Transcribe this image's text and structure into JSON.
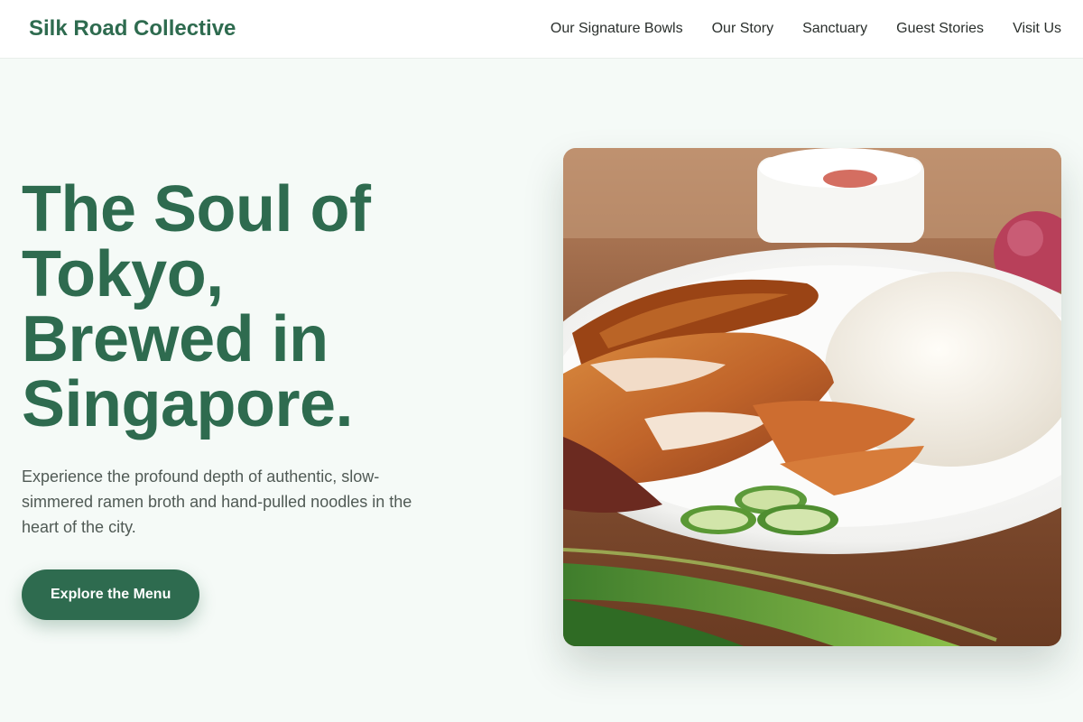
{
  "nav": {
    "brand": "Silk Road Collective",
    "links": [
      {
        "label": "Our Signature Bowls"
      },
      {
        "label": "Our Story"
      },
      {
        "label": "Sanctuary"
      },
      {
        "label": "Guest Stories"
      },
      {
        "label": "Visit Us"
      }
    ]
  },
  "hero": {
    "headline": "The Soul of Tokyo, Brewed in Singapore.",
    "subtext": "Experience the profound depth of authentic, slow-simmered ramen broth and hand-pulled noodles in the heart of the city.",
    "cta_label": "Explore the Menu"
  },
  "colors": {
    "brand": "#2e6b4f",
    "background": "#f5faf7",
    "text_muted": "#505a55"
  }
}
